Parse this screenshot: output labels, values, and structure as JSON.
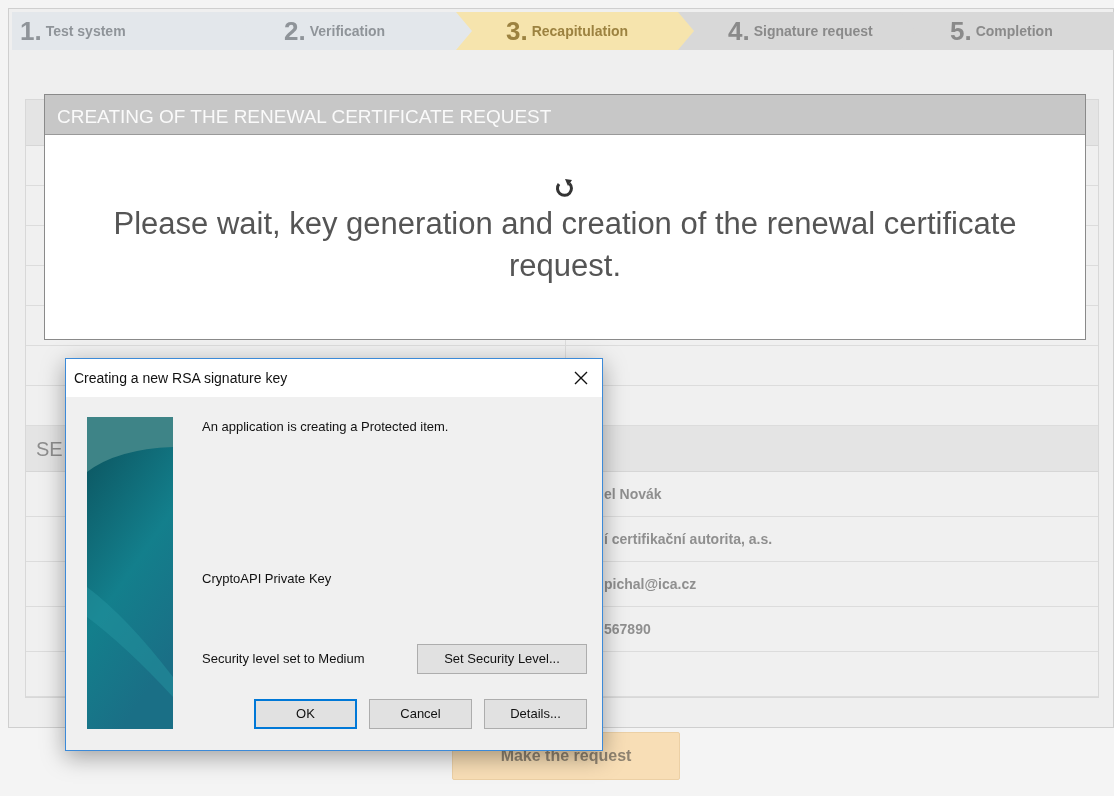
{
  "steps": [
    {
      "number": "1.",
      "label": "Test system",
      "completed": true,
      "selected": false
    },
    {
      "number": "2.",
      "label": "Verification",
      "completed": true,
      "selected": false
    },
    {
      "number": "3.",
      "label": "Recapitulation",
      "completed": false,
      "selected": true
    },
    {
      "number": "4.",
      "label": "Signature request",
      "completed": false,
      "selected": false
    },
    {
      "number": "5.",
      "label": "Completion",
      "completed": false,
      "selected": false
    }
  ],
  "section_heading": "SE",
  "value_rows": [
    "el Novák",
    "í certifikační autorita, a.s.",
    "pichal@ica.cz",
    "567890",
    ""
  ],
  "submit_button": "Make the request",
  "progress_modal": {
    "title": "CREATING OF THE RENEWAL CERTIFICATE REQUEST",
    "message": "Please wait, key generation and creation of the renewal certificate request."
  },
  "dialog": {
    "title": "Creating a new RSA signature key",
    "message": "An application is creating a Protected item.",
    "item_name": "CryptoAPI Private Key",
    "security_text": "Security level set to Medium",
    "security_button": "Set Security Level...",
    "buttons": [
      {
        "label": "OK",
        "focused": true
      },
      {
        "label": "Cancel",
        "focused": false
      },
      {
        "label": "Details...",
        "focused": false
      }
    ]
  }
}
